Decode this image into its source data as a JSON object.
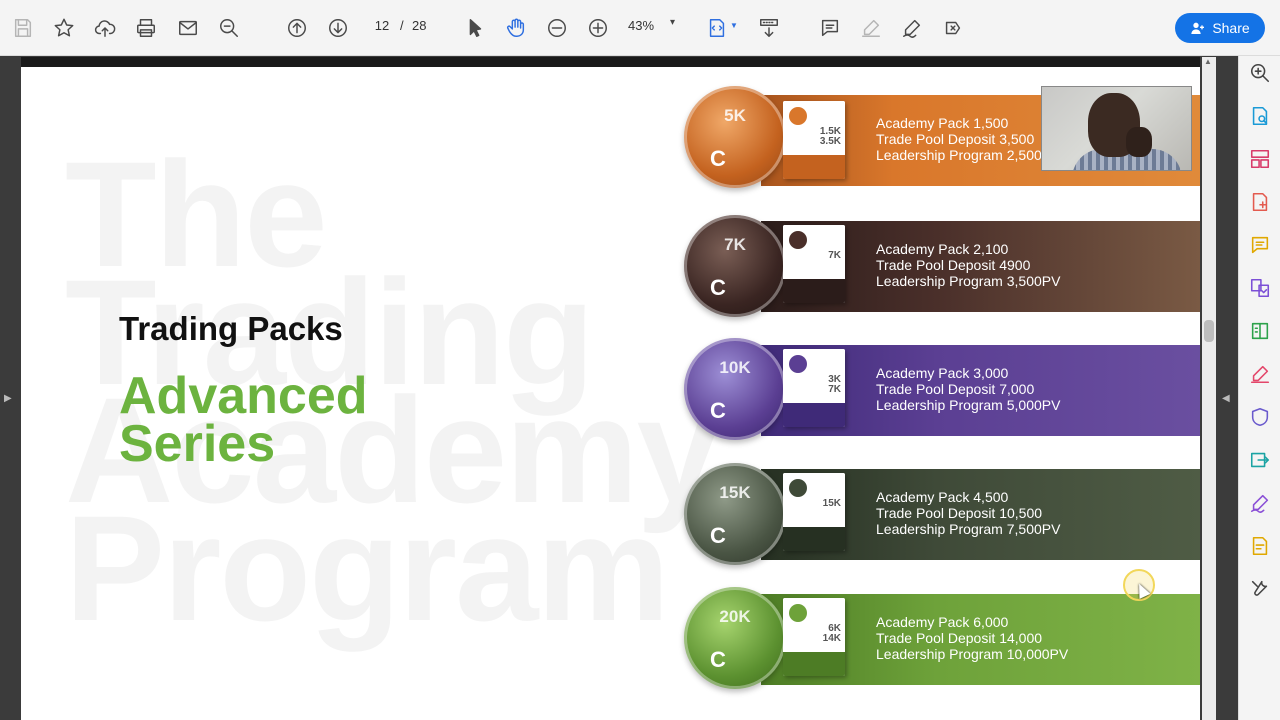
{
  "toolbar": {
    "page_current": "12",
    "page_separator": "/",
    "page_total": "28",
    "zoom": "43%",
    "share_label": "Share"
  },
  "slide": {
    "ghost_lines": [
      "The",
      "Trading",
      "Academy",
      "Program"
    ],
    "heading": "Trading Packs",
    "subheading": "Advanced Series",
    "packs": [
      {
        "coin": "5K",
        "box": "1.5K 3.5K",
        "academy": "Academy Pack 1,500",
        "trade_pool": "Trade Pool Deposit 3,500",
        "leadership": "Leadership Program 2,500PV",
        "color": "#d9772b"
      },
      {
        "coin": "7K",
        "box": "7K",
        "academy": "Academy Pack 2,100",
        "trade_pool": "Trade Pool Deposit 4900",
        "leadership": "Leadership Program 3,500PV",
        "color": "#4a2f2a"
      },
      {
        "coin": "10K",
        "box": "3K 7K",
        "academy": "Academy Pack 3,000",
        "trade_pool": "Trade Pool Deposit 7,000",
        "leadership": "Leadership Program 5,000PV",
        "color": "#5b3f93"
      },
      {
        "coin": "15K",
        "box": "15K",
        "academy": "Academy Pack 4,500",
        "trade_pool": "Trade Pool Deposit 10,500",
        "leadership": "Leadership Program 7,500PV",
        "color": "#3f4a38"
      },
      {
        "coin": "20K",
        "box": "6K 14K",
        "academy": "Academy Pack 6,000",
        "trade_pool": "Trade Pool Deposit 14,000",
        "leadership": "Leadership Program 10,000PV",
        "color": "#6ea23a"
      }
    ]
  },
  "colors": {
    "accent": "#1473e6",
    "green": "#6cb33f"
  }
}
